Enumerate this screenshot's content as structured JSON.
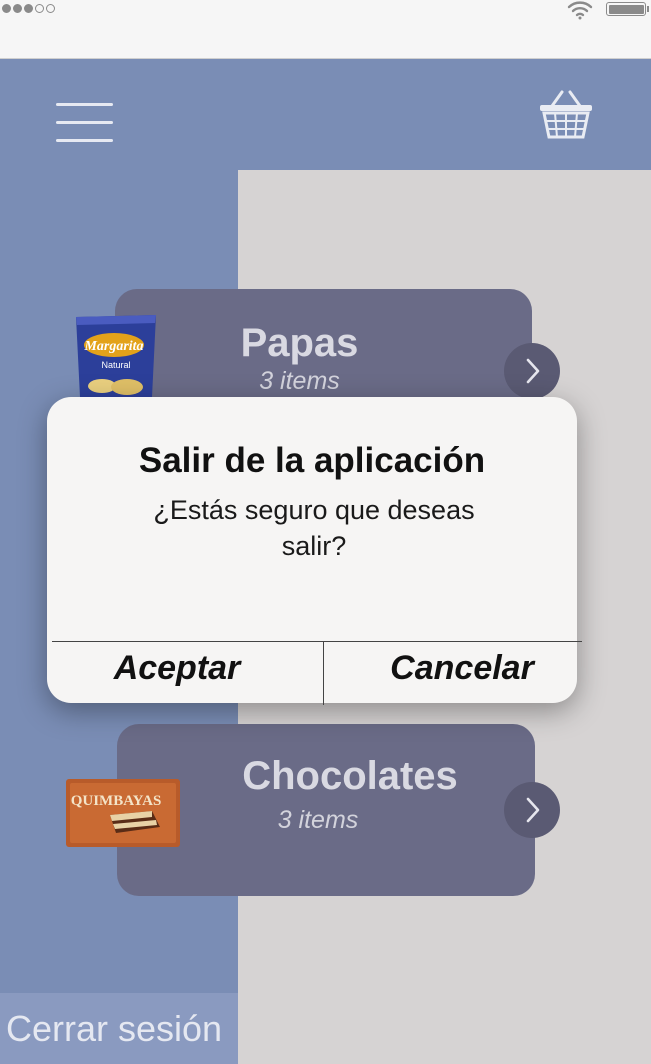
{
  "status_bar": {
    "signal_icon": "signal-dots-icon",
    "wifi_icon": "wifi-icon",
    "battery_icon": "battery-icon"
  },
  "header": {
    "menu_icon": "hamburger-menu-icon",
    "cart_icon": "shopping-basket-icon"
  },
  "categories": [
    {
      "title": "Papas",
      "subtitle": "3 items",
      "image_icon": "chips-bag-image"
    },
    {
      "title": "Chocolates",
      "subtitle": "3 items",
      "image_icon": "chocolate-bar-image"
    }
  ],
  "sidebar": {
    "logout_label": "Cerrar sesión"
  },
  "dialog": {
    "title": "Salir de la aplicación",
    "message": "¿Estás seguro que deseas salir?",
    "accept_label": "Aceptar",
    "cancel_label": "Cancelar"
  },
  "colors": {
    "header_bg": "#7a8db5",
    "content_bg": "#d6d3d3",
    "card_bg": "#6a6b87",
    "dialog_bg": "#f6f5f4"
  }
}
